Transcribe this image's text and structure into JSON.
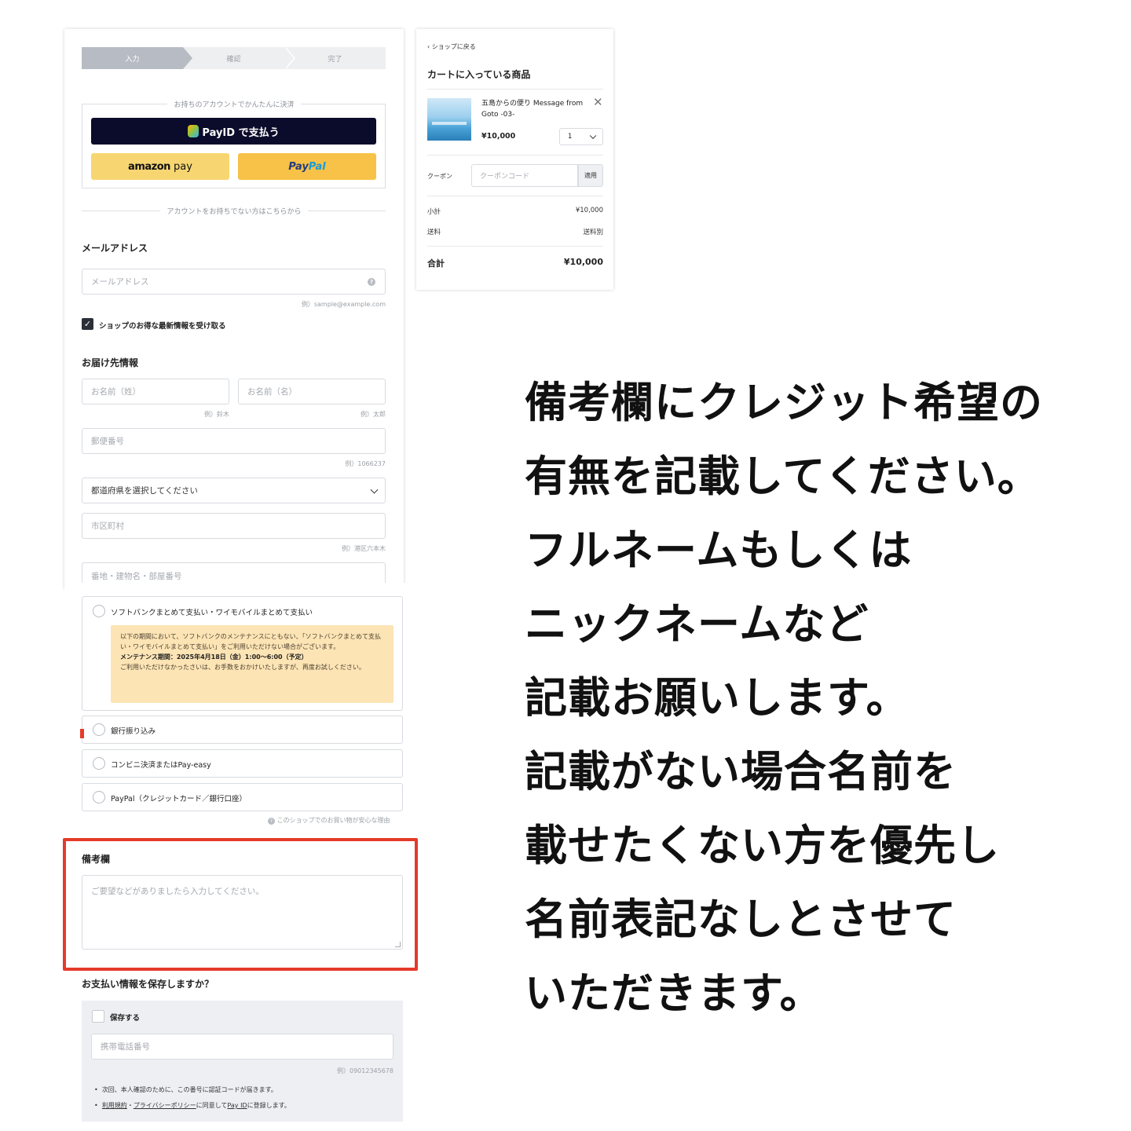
{
  "steps": [
    "入力",
    "確認",
    "完了"
  ],
  "account_section": {
    "legend": "お持ちのアカウントでかんたんに決済",
    "payid_label": "PayID で支払う",
    "amazon_label": "amazon",
    "amazon_suffix": "pay",
    "paypal_part1": "Pay",
    "paypal_part2": "Pal"
  },
  "guest_legend": "アカウントをお持ちでない方はこちらから",
  "email": {
    "label": "メールアドレス",
    "placeholder": "メールアドレス",
    "hint": "例）sample@example.com"
  },
  "newsletter_label": "ショップのお得な最新情報を受け取る",
  "shipping": {
    "title": "お届け先情報",
    "last_name_placeholder": "お名前（姓）",
    "last_name_hint": "例）鈴木",
    "first_name_placeholder": "お名前（名）",
    "first_name_hint": "例）太郎",
    "zip_placeholder": "郵便番号",
    "zip_hint": "例）1066237",
    "prefecture_value": "都道府県を選択してください",
    "city_placeholder": "市区町村",
    "city_hint": "例）港区六本木",
    "address_placeholder": "番地・建物名・部屋番号"
  },
  "payment": {
    "softbank_label": "ソフトバンクまとめて支払い・ワイモバイルまとめて支払い",
    "notice_text": "以下の期間において、ソフトバンクのメンテナンスにともない、「ソフトバンクまとめて支払い・ワイモバイルまとめて支払い」をご利用いただけない場合がございます。",
    "notice_period": "メンテナンス期間：2025年4月18日（金）1:00〜6:00（予定）",
    "notice_apology": "ご利用いただけなかったさいは、お手数をおかけいたしますが、再度お試しください。",
    "bank_label": "銀行振り込み",
    "konbini_label": "コンビニ決済またはPay-easy",
    "paypal_label": "PayPal（クレジットカード／銀行口座）",
    "safe_note": "このショップでのお買い物が安心な理由"
  },
  "remarks": {
    "label": "備考欄",
    "placeholder": "ご要望などがありましたら入力してください。"
  },
  "save_payment": {
    "question": "お支払い情報を保存しますか？",
    "checkbox_label": "保存する",
    "phone_placeholder": "携帯電話番号",
    "phone_hint": "例）09012345678",
    "bullet1": "次回、本人確認のために、この番号に認証コードが届きます。",
    "bullet2_link1": "利用規約",
    "bullet2_sep": "・",
    "bullet2_link2": "プライバシーポリシー",
    "bullet2_mid": "に同意してPay IDに登録します。",
    "bullet2_link3": "Pay ID",
    "bullet2_end": "に登録します。"
  },
  "cart": {
    "back_label": "ショップに戻る",
    "title": "カートに入っている商品",
    "product_name": "五島からの便り Message from Goto -03-",
    "product_price": "¥10,000",
    "quantity": "1",
    "coupon_label": "クーポン",
    "coupon_placeholder": "クーポンコード",
    "coupon_apply": "適用",
    "subtotal_label": "小計",
    "subtotal_value": "¥10,000",
    "shipping_label": "送料",
    "shipping_value": "送料別",
    "total_label": "合計",
    "total_value": "¥10,000"
  },
  "message_lines": [
    "備考欄にクレジット希望の",
    "有無を記載してください。",
    "フルネームもしくは",
    "ニックネームなど",
    "記載お願いします。",
    "記載がない場合名前を",
    "載せたくない方を優先し",
    "名前表記なしとさせて",
    "いただきます。"
  ],
  "colors": {
    "highlight_frame": "#e53a2a",
    "payid_button": "#0b0b2b",
    "amazon_button": "#f7d672",
    "paypal_button": "#f7c247",
    "notice_background": "#fde4b5"
  }
}
